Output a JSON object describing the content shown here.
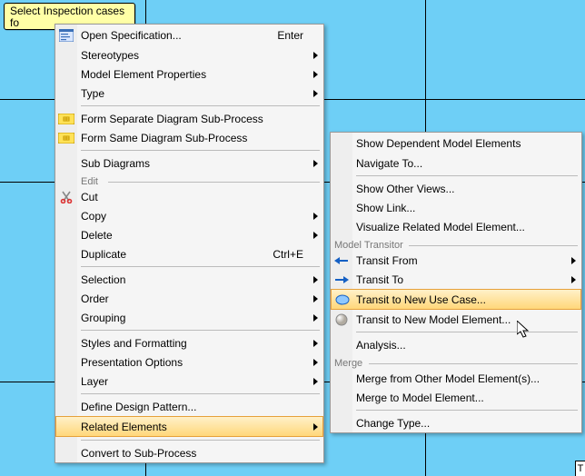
{
  "note": {
    "text": "Select Inspection cases fo"
  },
  "menu1": {
    "groupEdit": "Edit",
    "items": {
      "openSpec": {
        "label": "Open Specification...",
        "shortcut": "Enter"
      },
      "stereotypes": {
        "label": "Stereotypes"
      },
      "mep": {
        "label": "Model Element Properties"
      },
      "type": {
        "label": "Type"
      },
      "formSep": {
        "label": "Form Separate Diagram Sub-Process"
      },
      "formSame": {
        "label": "Form Same Diagram Sub-Process"
      },
      "subDiag": {
        "label": "Sub Diagrams"
      },
      "cut": {
        "label": "Cut"
      },
      "copy": {
        "label": "Copy"
      },
      "delete": {
        "label": "Delete"
      },
      "duplicate": {
        "label": "Duplicate",
        "shortcut": "Ctrl+E"
      },
      "selection": {
        "label": "Selection"
      },
      "order": {
        "label": "Order"
      },
      "grouping": {
        "label": "Grouping"
      },
      "styles": {
        "label": "Styles and Formatting"
      },
      "presentation": {
        "label": "Presentation Options"
      },
      "layer": {
        "label": "Layer"
      },
      "define": {
        "label": "Define Design Pattern..."
      },
      "related": {
        "label": "Related Elements"
      },
      "convert": {
        "label": "Convert to Sub-Process"
      }
    }
  },
  "menu2": {
    "groupTransitor": "Model Transitor",
    "groupMerge": "Merge",
    "items": {
      "showDep": {
        "label": "Show Dependent Model Elements"
      },
      "navTo": {
        "label": "Navigate To..."
      },
      "showViews": {
        "label": "Show Other Views..."
      },
      "showLink": {
        "label": "Show Link..."
      },
      "visualize": {
        "label": "Visualize Related Model Element..."
      },
      "transitFrom": {
        "label": "Transit From"
      },
      "transitTo": {
        "label": "Transit To"
      },
      "transitNewUC": {
        "label": "Transit to New Use Case..."
      },
      "transitNewME": {
        "label": "Transit to New Model Element..."
      },
      "analysis": {
        "label": "Analysis..."
      },
      "mergeFrom": {
        "label": "Merge from Other Model Element(s)..."
      },
      "mergeTo": {
        "label": "Merge to Model Element..."
      },
      "changeType": {
        "label": "Change Type..."
      }
    }
  },
  "tick": "T"
}
